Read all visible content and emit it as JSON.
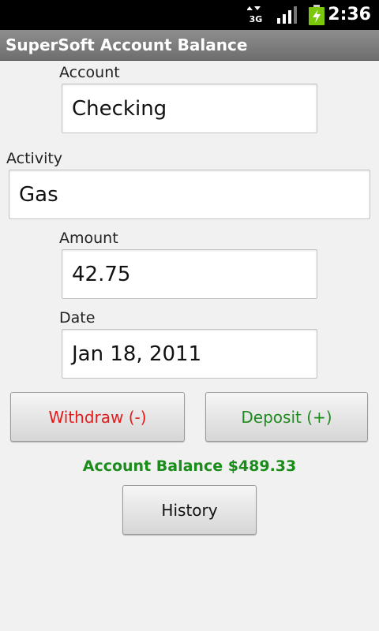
{
  "status_bar": {
    "network": "3G",
    "time": "2:36",
    "icons": [
      "3g-data-icon",
      "signal-strength-icon",
      "battery-charging-icon"
    ]
  },
  "app": {
    "title": "SuperSoft Account Balance"
  },
  "form": {
    "account_label": "Account",
    "account_value": "Checking",
    "activity_label": "Activity",
    "activity_value": "Gas",
    "amount_label": "Amount",
    "amount_value": "42.75",
    "date_label": "Date",
    "date_value": "Jan 18, 2011"
  },
  "buttons": {
    "withdraw_label": "Withdraw (-)",
    "deposit_label": "Deposit (+)",
    "history_label": "History"
  },
  "balance": {
    "text": "Account Balance $489.33"
  },
  "colors": {
    "withdraw": "#e31b1b",
    "deposit": "#1f8a1f",
    "balance": "#1a8c1a",
    "background": "#f1f1f1"
  }
}
